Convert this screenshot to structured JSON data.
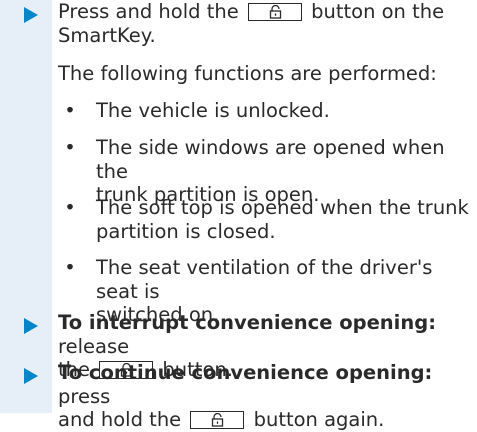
{
  "colors": {
    "accent": "#0086c9",
    "band": "#e6eff7",
    "text": "#2a2a2a"
  },
  "step1": {
    "before_key": "Press and hold the",
    "after_key": "button on the",
    "line2": "SmartKey."
  },
  "intro": "The following functions are performed:",
  "bullet_symbol": "•",
  "bullets": [
    {
      "lines": [
        "The vehicle is unlocked."
      ]
    },
    {
      "lines": [
        "The side windows are opened when the",
        "trunk partition is open."
      ]
    },
    {
      "lines": [
        "The soft top is opened when the trunk",
        "partition is closed."
      ]
    },
    {
      "lines": [
        "The seat ventilation of the driver's seat is",
        "switched on."
      ]
    }
  ],
  "step2": {
    "bold": "To interrupt convenience opening:",
    "after_bold": "release",
    "line2_before_key": "the",
    "line2_after_key": "button."
  },
  "step3": {
    "bold": "To continue convenience opening:",
    "after_bold": "press",
    "line2_before_key": "and hold the",
    "line2_after_key": "button again."
  },
  "icons": {
    "arrow": "triangle-right-icon",
    "key": "unlock-icon"
  }
}
